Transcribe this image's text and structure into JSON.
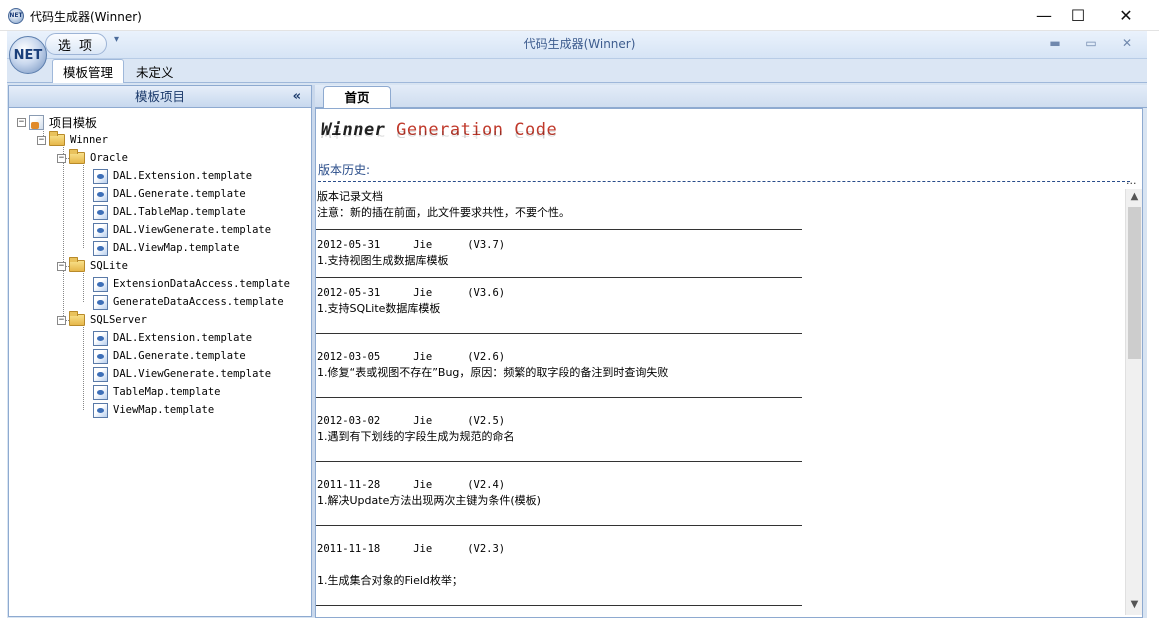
{
  "window": {
    "title": "代码生成器(Winner)",
    "controls": {
      "minimize": "—",
      "maximize": "☐",
      "close": "✕"
    }
  },
  "ribbon": {
    "orb_label": "NET",
    "options_label": "选 项",
    "qa_arrow": "▾",
    "title": "代码生成器(Winner)",
    "mdi": {
      "minimize": "▬",
      "restore": "▭",
      "close": "✕"
    },
    "tabs": [
      {
        "label": "模板管理"
      },
      {
        "label": "未定义"
      }
    ]
  },
  "left_panel": {
    "header": "模板项目",
    "collapse": "«",
    "tree": {
      "root": "项目模板",
      "winner": "Winner",
      "oracle": {
        "label": "Oracle",
        "files": [
          "DAL.Extension.template",
          "DAL.Generate.template",
          "DAL.TableMap.template",
          "DAL.ViewGenerate.template",
          "DAL.ViewMap.template"
        ]
      },
      "sqlite": {
        "label": "SQLite",
        "files": [
          "ExtensionDataAccess.template",
          "GenerateDataAccess.template"
        ]
      },
      "sqlserver": {
        "label": "SQLServer",
        "files": [
          "DAL.Extension.template",
          "DAL.Generate.template",
          "DAL.ViewGenerate.template",
          "TableMap.template",
          "ViewMap.template"
        ]
      }
    }
  },
  "document": {
    "tab": "首页",
    "banner": {
      "w": "Winner",
      "rest": " Generation Code"
    },
    "history_label": "版本历史:",
    "dots": "...",
    "intro": [
      "版本记录文档",
      "注意：新的插在前面，此文件要求共性，不要个性。"
    ],
    "entries": [
      {
        "date": "2012-05-31",
        "author": "Jie",
        "version": "(V3.7)",
        "text": "1.支持视图生成数据库模板"
      },
      {
        "date": "2012-05-31",
        "author": "Jie",
        "version": "(V3.6)",
        "text": "1.支持SQLite数据库模板"
      },
      {
        "date": "2012-03-05",
        "author": "Jie",
        "version": "(V2.6)",
        "text": "1.修复“表或视图不存在”Bug，原因：频繁的取字段的备注到时查询失败"
      },
      {
        "date": "2012-03-02",
        "author": "Jie",
        "version": "(V2.5)",
        "text": "1.遇到有下划线的字段生成为规范的命名"
      },
      {
        "date": "2011-11-28",
        "author": "Jie",
        "version": "(V2.4)",
        "text": "1.解决Update方法出现两次主键为条件(模板)"
      },
      {
        "date": "2011-11-18",
        "author": "Jie",
        "version": "(V2.3)",
        "text": "1.生成集合对象的Field枚举；"
      }
    ]
  },
  "scrollbar": {
    "up": "▲",
    "down": "▼",
    "position": 0.0
  }
}
